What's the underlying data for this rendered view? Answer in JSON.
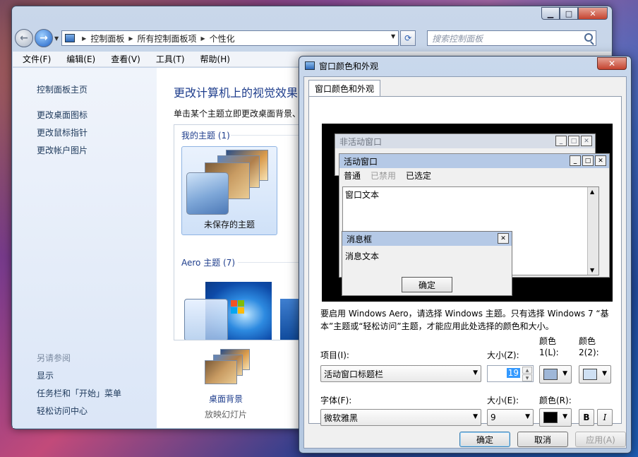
{
  "explorer": {
    "back_glyph": "←",
    "forward_glyph": "→",
    "breadcrumbs": [
      "控制面板",
      "所有控制面板项",
      "个性化"
    ],
    "search_placeholder": "搜索控制面板",
    "menu": [
      "文件(F)",
      "编辑(E)",
      "查看(V)",
      "工具(T)",
      "帮助(H)"
    ],
    "sidebar": {
      "home_link": "控制面板主页",
      "links": [
        "更改桌面图标",
        "更改鼠标指针",
        "更改帐户图片"
      ],
      "see_also_label": "另请参阅",
      "see_also_links": [
        "显示",
        "任务栏和「开始」菜单",
        "轻松访问中心"
      ]
    },
    "content": {
      "title": "更改计算机上的视觉效果",
      "subtitle": "单击某个主题立即更改桌面背景、",
      "my_themes_label": "我的主题 (1)",
      "unsaved_theme_label": "未保存的主题",
      "aero_themes_label": "Aero 主题 (7)",
      "desktop_bg_label": "桌面背景",
      "desktop_bg_sub": "放映幻灯片"
    }
  },
  "dialog": {
    "title": "窗口颜色和外观",
    "close_glyph": "✕",
    "tab_label": "窗口颜色和外观",
    "preview": {
      "inactive_title": "非活动窗口",
      "active_title": "活动窗口",
      "menu_normal": "普通",
      "menu_disabled": "已禁用",
      "menu_selected": "已选定",
      "window_text": "窗口文本",
      "msgbox_title": "消息框",
      "msgbox_text": "消息文本",
      "ok": "确定"
    },
    "info_text": "要启用 Windows Aero，请选择 Windows 主题。只有选择 Windows 7 “基本”主题或“轻松访问”主题，才能应用此处选择的颜色和大小。",
    "item_label": "项目(I):",
    "item_value": "活动窗口标题栏",
    "size1_label": "大小(Z):",
    "size1_value": "19",
    "color1_label": "颜色 1(L):",
    "color2_label": "颜色 2(2):",
    "color1_swatch": "#9fb7d8",
    "color2_swatch": "#cfe0f3",
    "font_label": "字体(F):",
    "font_value": "微软雅黑",
    "size2_label": "大小(E):",
    "size2_value": "9",
    "fontcolor_label": "颜色(R):",
    "fontcolor_swatch": "#000000",
    "bold_label": "B",
    "italic_label": "I",
    "ok_label": "确定",
    "cancel_label": "取消",
    "apply_label": "应用(A)"
  }
}
